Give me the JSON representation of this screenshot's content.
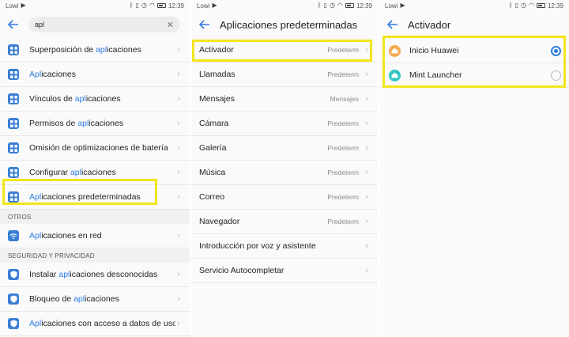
{
  "status": {
    "carrier": "Lowi",
    "time": "12:39"
  },
  "search_panel": {
    "query": "apl",
    "items": [
      {
        "pre": "Superposición de ",
        "hl": "apl",
        "post": "icaciones"
      },
      {
        "pre": "",
        "hl": "Apl",
        "post": "icaciones"
      },
      {
        "pre": "Vínculos de ",
        "hl": "apl",
        "post": "icaciones"
      },
      {
        "pre": "Permisos de ",
        "hl": "apl",
        "post": "icaciones"
      },
      {
        "pre": "Omisión de optimizaciones de batería",
        "hl": "",
        "post": ""
      },
      {
        "pre": "Configurar ",
        "hl": "apl",
        "post": "icaciones"
      },
      {
        "pre": "",
        "hl": "Apl",
        "post": "icaciones predeterminadas"
      }
    ],
    "section_otros": "OTROS",
    "otros_items": [
      {
        "pre": "",
        "hl": "Apl",
        "post": "icaciones en red"
      }
    ],
    "section_seguridad": "SEGURIDAD Y PRIVACIDAD",
    "seguridad_items": [
      {
        "pre": "Instalar ",
        "hl": "apl",
        "post": "icaciones desconocidas"
      },
      {
        "pre": "Bloqueo de ",
        "hl": "apl",
        "post": "icaciones"
      },
      {
        "pre": "",
        "hl": "Apl",
        "post": "icaciones con acceso a datos de uso"
      }
    ]
  },
  "defaults_panel": {
    "title": "Aplicaciones predeterminadas",
    "items": [
      {
        "label": "Activador",
        "value": "Predeterm"
      },
      {
        "label": "Llamadas",
        "value": "Predeterm"
      },
      {
        "label": "Mensajes",
        "value": "Mensajes"
      },
      {
        "label": "Cámara",
        "value": "Predeterm"
      },
      {
        "label": "Galería",
        "value": "Predeterm"
      },
      {
        "label": "Música",
        "value": "Predeterm"
      },
      {
        "label": "Correo",
        "value": "Predeterm"
      },
      {
        "label": "Navegador",
        "value": "Predeterm"
      },
      {
        "label": "Introducción por voz y asistente",
        "value": ""
      },
      {
        "label": "Servicio Autocompletar",
        "value": ""
      }
    ]
  },
  "launcher_panel": {
    "title": "Activador",
    "options": [
      {
        "label": "Inicio Huawei",
        "selected": true,
        "icon_color": "#f2a94e"
      },
      {
        "label": "Mint Launcher",
        "selected": false,
        "icon_color": "#33c6c6"
      }
    ]
  },
  "colors": {
    "accent": "#2f7be0",
    "highlight_box": "#f2e51c"
  }
}
